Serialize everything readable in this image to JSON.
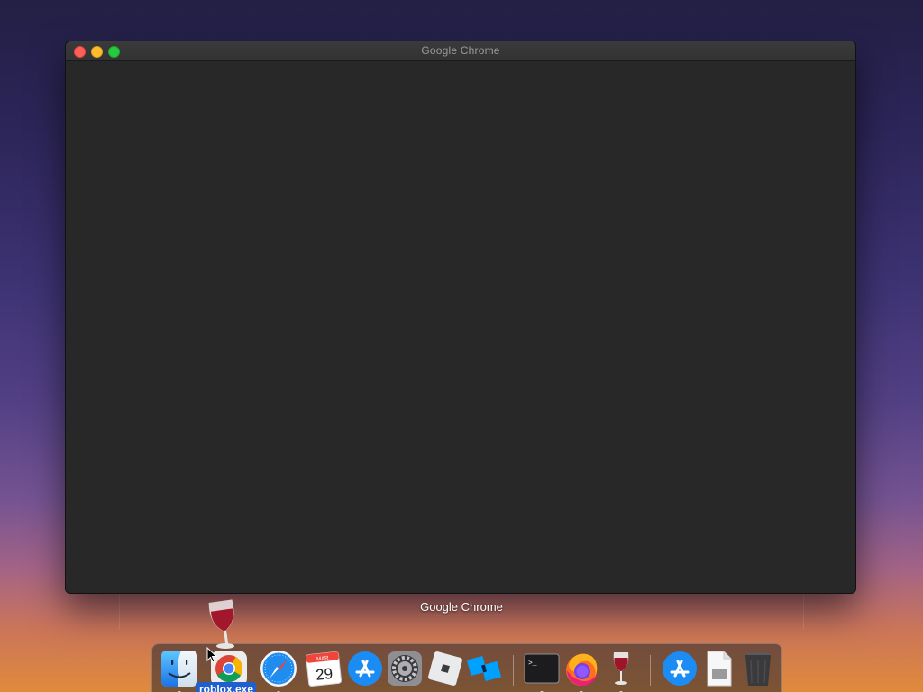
{
  "window": {
    "title": "Google Chrome",
    "label": "Google Chrome"
  },
  "dock": {
    "items": [
      {
        "name": "finder",
        "icon": "finder-icon",
        "running": true
      },
      {
        "name": "google-chrome",
        "icon": "chrome-icon",
        "running": false
      },
      {
        "name": "safari",
        "icon": "safari-icon",
        "running": true
      },
      {
        "name": "calendar",
        "icon": "calendar-icon",
        "month": "MAR",
        "day": "29",
        "running": false
      },
      {
        "name": "app-store",
        "icon": "app-store-icon",
        "running": false
      },
      {
        "name": "system-preferences",
        "icon": "gear-icon",
        "running": false
      },
      {
        "name": "roblox",
        "icon": "roblox-icon",
        "running": false
      },
      {
        "name": "roblox-studio",
        "icon": "roblox-studio-icon",
        "running": false
      },
      {
        "name": "terminal",
        "icon": "terminal-icon",
        "prompt": ">_",
        "running": true
      },
      {
        "name": "firefox",
        "icon": "firefox-icon",
        "running": true
      },
      {
        "name": "wine",
        "icon": "wine-icon",
        "running": true
      },
      {
        "name": "app-store-downloads",
        "icon": "app-store-icon",
        "running": false
      },
      {
        "name": "document-stack",
        "icon": "document-icon",
        "running": false
      },
      {
        "name": "trash",
        "icon": "trash-icon",
        "running": false
      }
    ]
  },
  "drag": {
    "icon": "wine-icon",
    "label": "roblox.exe"
  }
}
